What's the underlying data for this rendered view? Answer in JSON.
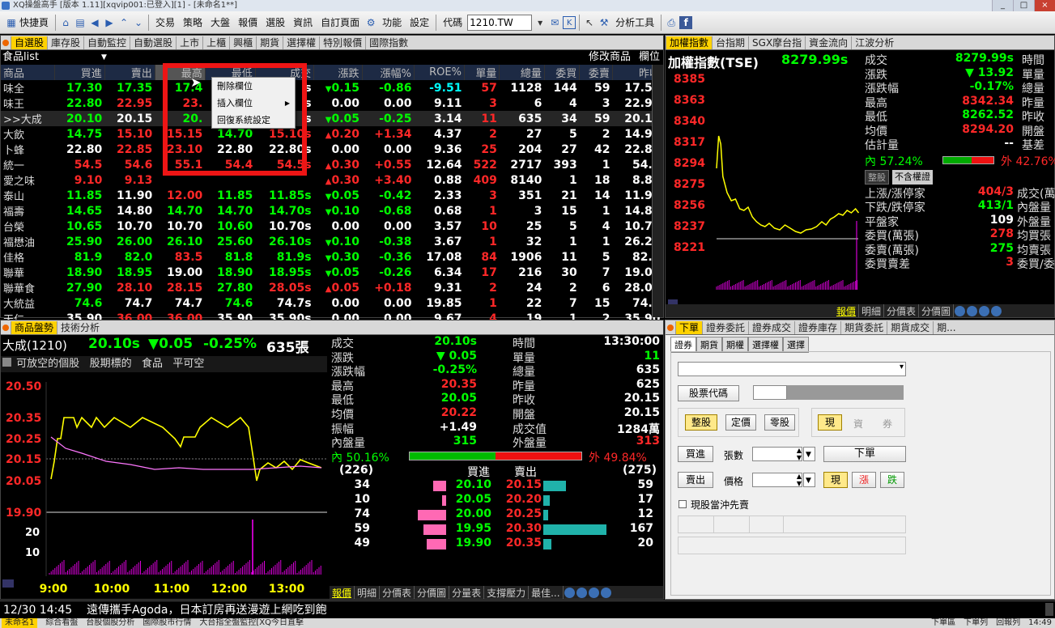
{
  "window": {
    "title": "XQ操盤高手 [版本 1.11][xqvip001:已登入][1] - [未命名1**]",
    "buttons": [
      "_",
      "□",
      "×"
    ]
  },
  "toolbar": {
    "quick": "快捷頁",
    "menus": [
      "交易",
      "策略",
      "大盤",
      "報價",
      "選股",
      "資訊",
      "自訂頁面",
      "功能",
      "設定"
    ],
    "code_label": "代碼",
    "code_value": "1210.TW",
    "analysis": "分析工具"
  },
  "quote_panel": {
    "tabs": [
      "自選股",
      "庫存股",
      "自動監控",
      "自動選股",
      "上市",
      "上櫃",
      "興櫃",
      "期貨",
      "選擇權",
      "特別報價",
      "國際指數"
    ],
    "list_name": "食品list",
    "edit_label": "修改商品",
    "col_label": "欄位",
    "headers": [
      "商品",
      "買進",
      "賣出",
      "最高",
      "最低",
      "成交",
      "漲跌",
      "漲幅%",
      "ROE%",
      "單量",
      "總量",
      "委買",
      "委賣",
      "昨收"
    ],
    "rows": [
      {
        "name": "味全",
        "bid": "17.30",
        "ask": "17.35",
        "high": "17.4",
        "low": "17.30",
        "close": "s",
        "chg": "0.15",
        "dir": "dn",
        "pct": "-0.86",
        "roe": "-9.51",
        "vol": "57",
        "total": "1128",
        "buy": "144",
        "sell": "59",
        "prev": "17.50"
      },
      {
        "name": "味王",
        "bid": "22.80",
        "ask": "22.95",
        "high": "23.",
        "low": "",
        "close": "s",
        "chg": "0.00",
        "dir": "",
        "pct": "0.00",
        "roe": "9.11",
        "vol": "3",
        "total": "6",
        "buy": "4",
        "sell": "3",
        "prev": "22.90"
      },
      {
        "name": ">>大成",
        "bid": "20.10",
        "ask": "20.15",
        "high": "20.",
        "low": "",
        "close": "s",
        "chg": "0.05",
        "dir": "dn",
        "pct": "-0.25",
        "roe": "3.14",
        "vol": "11",
        "total": "635",
        "buy": "34",
        "sell": "59",
        "prev": "20.15"
      },
      {
        "name": "大飲",
        "bid": "14.75",
        "ask": "15.10",
        "high": "15.15",
        "low": "14.70",
        "close": "15.10s",
        "chg": "0.20",
        "dir": "up",
        "pct": "+1.34",
        "roe": "4.37",
        "vol": "2",
        "total": "27",
        "buy": "5",
        "sell": "2",
        "prev": "14.90"
      },
      {
        "name": "卜蜂",
        "bid": "22.80",
        "ask": "22.85",
        "high": "23.10",
        "low": "22.80",
        "close": "22.80s",
        "chg": "0.00",
        "dir": "",
        "pct": "0.00",
        "roe": "9.36",
        "vol": "25",
        "total": "204",
        "buy": "27",
        "sell": "42",
        "prev": "22.80"
      },
      {
        "name": "統一",
        "bid": "54.5",
        "ask": "54.6",
        "high": "55.1",
        "low": "54.4",
        "close": "54.5s",
        "chg": "0.30",
        "dir": "up",
        "pct": "+0.55",
        "roe": "12.64",
        "vol": "522",
        "total": "2717",
        "buy": "393",
        "sell": "1",
        "prev": "54.2"
      },
      {
        "name": "愛之味",
        "bid": "9.10",
        "ask": "9.13",
        "high": "",
        "low": "",
        "close": "",
        "chg": "0.30",
        "dir": "up",
        "pct": "+3.40",
        "roe": "0.88",
        "vol": "409",
        "total": "8140",
        "buy": "1",
        "sell": "18",
        "prev": "8.83"
      },
      {
        "name": "泰山",
        "bid": "11.85",
        "ask": "11.90",
        "high": "12.00",
        "low": "11.85",
        "close": "11.85s",
        "chg": "0.05",
        "dir": "dn",
        "pct": "-0.42",
        "roe": "2.33",
        "vol": "3",
        "total": "351",
        "buy": "21",
        "sell": "14",
        "prev": "11.90"
      },
      {
        "name": "福壽",
        "bid": "14.65",
        "ask": "14.80",
        "high": "14.70",
        "low": "14.70",
        "close": "14.70s",
        "chg": "0.10",
        "dir": "dn",
        "pct": "-0.68",
        "roe": "0.68",
        "vol": "1",
        "total": "3",
        "buy": "15",
        "sell": "1",
        "prev": "14.80"
      },
      {
        "name": "台榮",
        "bid": "10.65",
        "ask": "10.70",
        "high": "10.70",
        "low": "10.60",
        "close": "10.70s",
        "chg": "0.00",
        "dir": "",
        "pct": "0.00",
        "roe": "3.57",
        "vol": "10",
        "total": "25",
        "buy": "5",
        "sell": "4",
        "prev": "10.70"
      },
      {
        "name": "福懋油",
        "bid": "25.90",
        "ask": "26.00",
        "high": "26.10",
        "low": "25.60",
        "close": "26.10s",
        "chg": "0.10",
        "dir": "dn",
        "pct": "-0.38",
        "roe": "3.67",
        "vol": "1",
        "total": "32",
        "buy": "1",
        "sell": "1",
        "prev": "26.20"
      },
      {
        "name": "佳格",
        "bid": "81.9",
        "ask": "82.0",
        "high": "83.5",
        "low": "81.8",
        "close": "81.9s",
        "chg": "0.30",
        "dir": "dn",
        "pct": "-0.36",
        "roe": "17.08",
        "vol": "84",
        "total": "1906",
        "buy": "11",
        "sell": "5",
        "prev": "82.2"
      },
      {
        "name": "聯華",
        "bid": "18.90",
        "ask": "18.95",
        "high": "19.00",
        "low": "18.90",
        "close": "18.95s",
        "chg": "0.05",
        "dir": "dn",
        "pct": "-0.26",
        "roe": "6.34",
        "vol": "17",
        "total": "216",
        "buy": "30",
        "sell": "7",
        "prev": "19.00"
      },
      {
        "name": "聯華食",
        "bid": "27.90",
        "ask": "28.10",
        "high": "28.15",
        "low": "27.80",
        "close": "28.05s",
        "chg": "0.05",
        "dir": "up",
        "pct": "+0.18",
        "roe": "9.31",
        "vol": "2",
        "total": "24",
        "buy": "2",
        "sell": "6",
        "prev": "28.00"
      },
      {
        "name": "大統益",
        "bid": "74.6",
        "ask": "74.7",
        "high": "74.7",
        "low": "74.6",
        "close": "74.7s",
        "chg": "0.00",
        "dir": "",
        "pct": "0.00",
        "roe": "19.85",
        "vol": "1",
        "total": "22",
        "buy": "7",
        "sell": "15",
        "prev": "74.7"
      },
      {
        "name": "天仁",
        "bid": "35.90",
        "ask": "36.00",
        "high": "36.00",
        "low": "35.90",
        "close": "35.90s",
        "chg": "0.00",
        "dir": "",
        "pct": "0.00",
        "roe": "9.67",
        "vol": "4",
        "total": "19",
        "buy": "1",
        "sell": "2",
        "prev": "35.90"
      }
    ]
  },
  "context_menu": {
    "items": [
      "刪除欄位",
      "插入欄位",
      "回復系統設定"
    ],
    "submenu_arrow": "▶"
  },
  "index_panel": {
    "tabs": [
      "加權指數",
      "台指期",
      "SGX摩台指",
      "資金流向",
      "江波分析"
    ],
    "title": "加權指數(TSE)",
    "value": "8279.99s",
    "yticks": [
      "8385",
      "8363",
      "8340",
      "8317",
      "8294",
      "8275",
      "8256",
      "8237",
      "8221"
    ],
    "xticks": [
      "9:00",
      "11:00",
      "13:00"
    ],
    "info": [
      {
        "k": "成交",
        "v": "8279.99s",
        "c": "g",
        "k2": "時間"
      },
      {
        "k": "漲跌",
        "v": "▼ 13.92",
        "c": "g",
        "k2": "單量"
      },
      {
        "k": "漲跌幅",
        "v": "-0.17%",
        "c": "g",
        "k2": "總量"
      },
      {
        "k": "最高",
        "v": "8342.34",
        "c": "r",
        "k2": "昨量"
      },
      {
        "k": "最低",
        "v": "8262.52",
        "c": "g",
        "k2": "昨收"
      },
      {
        "k": "均價",
        "v": "8294.20",
        "c": "r",
        "k2": "開盤"
      },
      {
        "k": "估計量",
        "v": "--",
        "c": "w",
        "k2": "基差"
      }
    ],
    "inner_pct": "內 57.24%",
    "outer_pct": "外 42.76%",
    "badges": [
      "整股",
      "不含權證"
    ],
    "breadth": [
      {
        "k": "上漲/漲停家",
        "v": "404/3",
        "c": "r",
        "k2": "成交(萬..."
      },
      {
        "k": "下跌/跌停家",
        "v": "413/1",
        "c": "g",
        "k2": "內盤量"
      },
      {
        "k": "平盤家",
        "v": "109",
        "c": "w",
        "k2": "外盤量"
      },
      {
        "k": "委買(萬張)",
        "v": "278",
        "c": "r",
        "k2": "均買張"
      },
      {
        "k": "委賣(萬張)",
        "v": "275",
        "c": "g",
        "k2": "均賣張"
      },
      {
        "k": "委買賣差",
        "v": "3",
        "c": "r",
        "k2": "委買/委賣"
      }
    ],
    "bottom_tabs": [
      "報價",
      "明細",
      "分價表",
      "分價圖"
    ]
  },
  "stock_panel": {
    "tabs": [
      "商品盤勢",
      "技術分析"
    ],
    "title": "大成(1210)",
    "price": "20.10s",
    "change": "▼0.05",
    "pct": "-0.25%",
    "vol": "635張",
    "tags": [
      "可放空的個股",
      "股期標的",
      "食品",
      "平可空"
    ],
    "yticks": [
      "20.50",
      "20.35",
      "20.25",
      "20.15",
      "20.05",
      "19.90"
    ],
    "vticks": [
      "20",
      "10"
    ],
    "xticks": [
      "9:00",
      "10:00",
      "11:00",
      "12:00",
      "13:00"
    ],
    "info_left": [
      {
        "k": "成交",
        "v": "20.10s",
        "c": "g"
      },
      {
        "k": "漲跌",
        "v": "▼ 0.05",
        "c": "g"
      },
      {
        "k": "漲跌幅",
        "v": "-0.25%",
        "c": "g"
      },
      {
        "k": "最高",
        "v": "20.35",
        "c": "r"
      },
      {
        "k": "最低",
        "v": "20.05",
        "c": "g"
      },
      {
        "k": "均價",
        "v": "20.22",
        "c": "r"
      },
      {
        "k": "振幅",
        "v": "+1.49",
        "c": "w"
      },
      {
        "k": "內盤量",
        "v": "315",
        "c": "g"
      }
    ],
    "info_right": [
      {
        "k": "時間",
        "v": "13:30:00",
        "c": "w"
      },
      {
        "k": "單量",
        "v": "11",
        "c": "g"
      },
      {
        "k": "總量",
        "v": "635",
        "c": "w"
      },
      {
        "k": "昨量",
        "v": "625",
        "c": "w"
      },
      {
        "k": "昨收",
        "v": "20.15",
        "c": "w"
      },
      {
        "k": "開盤",
        "v": "20.15",
        "c": "w"
      },
      {
        "k": "成交值",
        "v": "1284萬",
        "c": "w"
      },
      {
        "k": "外盤量",
        "v": "313",
        "c": "r"
      }
    ],
    "inner": "內 50.16%",
    "outer": "外 49.84%",
    "book_head": {
      "left": "(226)",
      "bid": "買進",
      "ask": "賣出",
      "right": "(275)"
    },
    "book": [
      {
        "bq": "34",
        "bid": "20.10",
        "ask": "20.15",
        "aq": "59",
        "bw": 16,
        "aw": 28
      },
      {
        "bq": "10",
        "bid": "20.05",
        "ask": "20.20",
        "aq": "17",
        "bw": 5,
        "aw": 8
      },
      {
        "bq": "74",
        "bid": "20.00",
        "ask": "20.25",
        "aq": "12",
        "bw": 35,
        "aw": 6
      },
      {
        "bq": "59",
        "bid": "19.95",
        "ask": "20.30",
        "aq": "167",
        "bw": 28,
        "aw": 78
      },
      {
        "bq": "49",
        "bid": "19.90",
        "ask": "20.35",
        "aq": "20",
        "bw": 24,
        "aw": 10
      }
    ],
    "bottom_tabs": [
      "報價",
      "明細",
      "分價表",
      "分價圖",
      "分量表",
      "支撐壓力",
      "最佳..."
    ]
  },
  "order_panel": {
    "tabs": [
      "下單",
      "證券委託",
      "證券成交",
      "證券庫存",
      "期貨委託",
      "期貨成交",
      "期..."
    ],
    "subtabs": [
      "證券",
      "期貨",
      "期權",
      "選擇權",
      "選擇"
    ],
    "code_label": "股票代碼",
    "lot_buttons": [
      "整股",
      "定價",
      "零股"
    ],
    "type_buttons": [
      "現",
      "資",
      "券"
    ],
    "buy": "買進",
    "sell": "賣出",
    "qty": "張數",
    "price": "價格",
    "submit": "下單",
    "price_buttons": [
      "現",
      "漲",
      "跌"
    ],
    "daytrade": "現股當沖先賣"
  },
  "news": {
    "time": "12/30 14:45",
    "text": "遠傳攜手Agoda，日本訂房再送漫遊上網吃到飽"
  },
  "taskbar": {
    "items": [
      "未命名1",
      "綜合看盤",
      "台股個股分析",
      "國際股市行情",
      "大台指全盤監控[XQ今日直擊"
    ],
    "right": [
      "下單區",
      "下單列",
      "回報列",
      "14:49"
    ]
  }
}
